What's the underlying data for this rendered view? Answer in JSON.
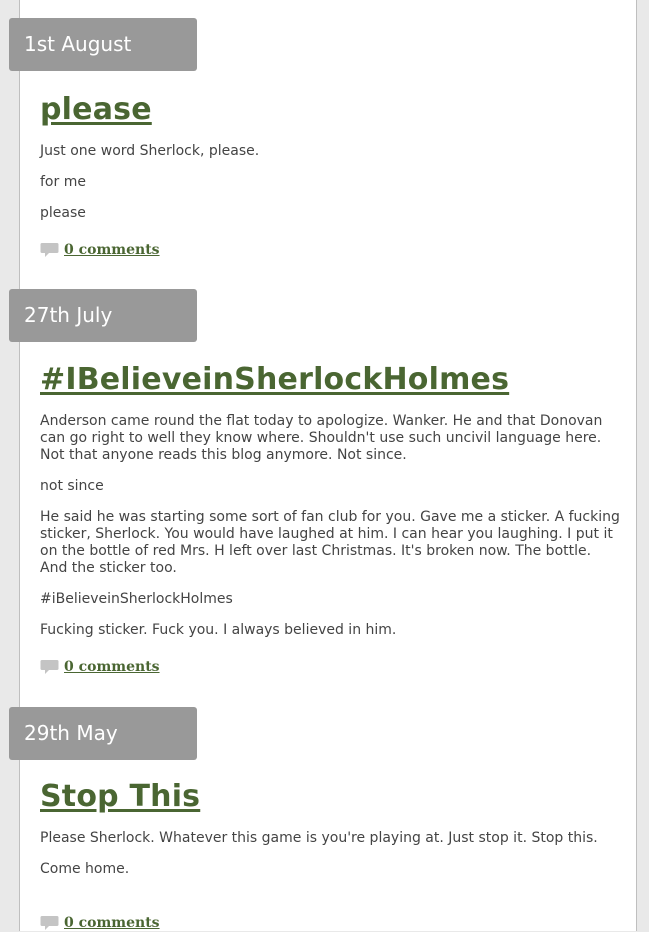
{
  "posts": [
    {
      "date": "1st August",
      "title": "please",
      "paragraphs": [
        "Just one word Sherlock, please.",
        "for me",
        "please"
      ],
      "comments": "0 comments"
    },
    {
      "date": "27th July",
      "title": "#IBelieveinSherlockHolmes",
      "paragraphs": [
        "Anderson came round the flat today to apologize.  Wanker.  He and that Donovan can go right to well they know where.  Shouldn't use such uncivil language here.  Not that anyone reads this blog anymore. Not since.",
        "not since",
        "He said he was starting some sort of fan club for you.  Gave me a sticker.  A fucking sticker, Sherlock.  You would have laughed at him.  I can hear you laughing.  I put it on the bottle of red Mrs. H left over last Christmas.  It's broken now.  The bottle.  And the sticker too.",
        "#iBelieveinSherlockHolmes",
        "Fucking sticker.  Fuck you.  I always believed in him."
      ],
      "comments": "0 comments"
    },
    {
      "date": "29th May",
      "title": "Stop This",
      "paragraphs": [
        "Please Sherlock. Whatever this game is you're playing at.  Just stop it.  Stop this.",
        "Come home."
      ],
      "comments": "0 comments"
    }
  ],
  "colors": {
    "accent": "#4a6632",
    "date_tab": "#999999",
    "text": "#444444",
    "icon": "#c4c4c4"
  },
  "icons": {
    "comments": "speech-bubble-icon"
  }
}
